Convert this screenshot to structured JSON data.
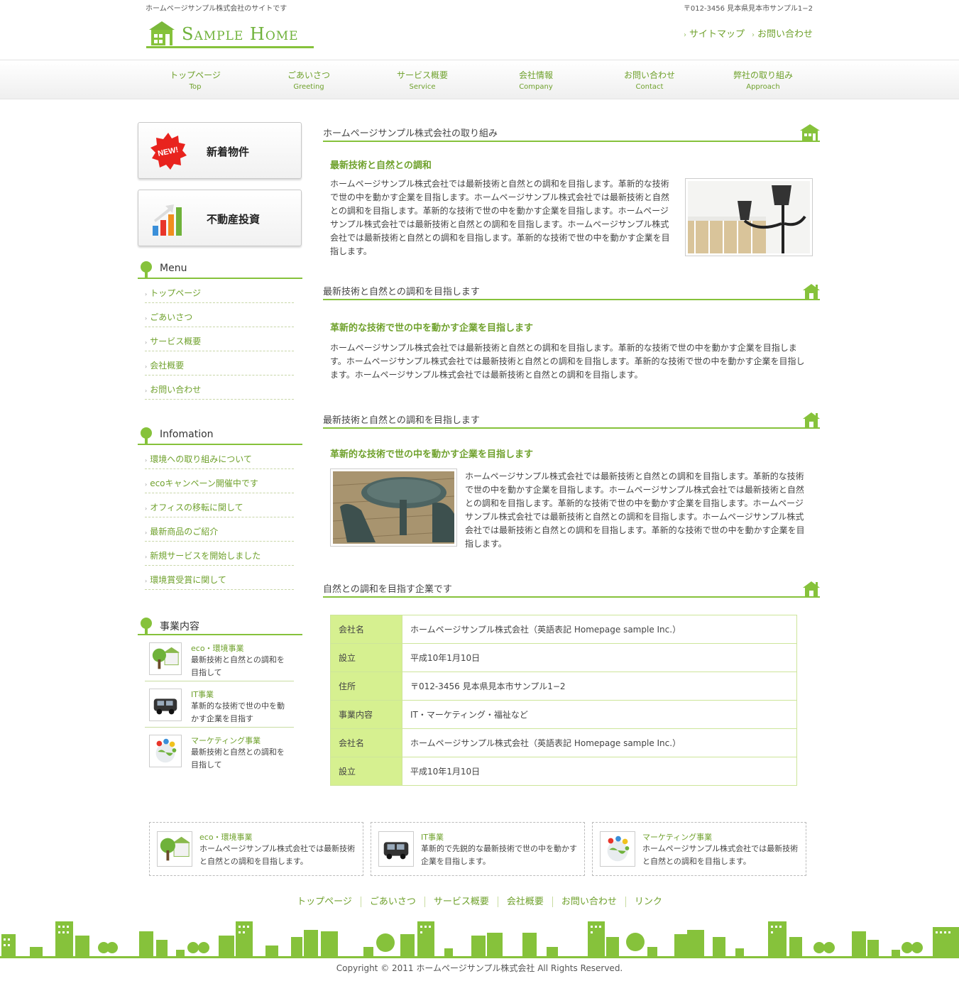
{
  "colors": {
    "accent": "#86c23b",
    "link": "#6fa12c",
    "table_key_bg": "#d6f090"
  },
  "header": {
    "tagline": "ホームページサンプル株式会社のサイトです",
    "address": "〒012-3456 見本県見本市サンプル1−2",
    "logo_text": "Sample Home",
    "links": [
      "サイトマップ",
      "お問い合わせ"
    ]
  },
  "gnav": [
    {
      "jp": "トップページ",
      "en": "Top"
    },
    {
      "jp": "ごあいさつ",
      "en": "Greeting"
    },
    {
      "jp": "サービス概要",
      "en": "Service"
    },
    {
      "jp": "会社情報",
      "en": "Company"
    },
    {
      "jp": "お問い合わせ",
      "en": "Contact"
    },
    {
      "jp": "弊社の取り組み",
      "en": "Approach"
    }
  ],
  "sidebar": {
    "new_button": {
      "badge": "NEW!",
      "label": "新着物件"
    },
    "invest_button": {
      "label": "不動産投資"
    },
    "menu_title": "Menu",
    "menu_items": [
      "トップページ",
      "ごあいさつ",
      "サービス概要",
      "会社概要",
      "お問い合わせ"
    ],
    "info_title": "Infomation",
    "info_items": [
      "環境への取り組みについて",
      "ecoキャンペーン開催中です",
      "オフィスの移転に関して",
      "最新商品のご紹介",
      "新規サービスを開始しました",
      "環境賞受賞に関して"
    ],
    "biz_title": "事業内容",
    "biz_items": [
      {
        "title": "eco・環境事業",
        "desc": "最新技術と自然との調和を目指して",
        "icon": "eco-house-icon"
      },
      {
        "title": "IT事業",
        "desc": "革新的な技術で世の中を動かす企業を目指す",
        "icon": "car-icon"
      },
      {
        "title": "マーケティング事業",
        "desc": "最新技術と自然との調和を目指して",
        "icon": "globe-icon"
      }
    ]
  },
  "main": {
    "sections": [
      {
        "title": "ホームページサンプル株式会社の取り組み",
        "subtitle": "最新技術と自然との調和",
        "text": "ホームページサンプル株式会社では最新技術と自然との調和を目指します。革新的な技術で世の中を動かす企業を目指します。ホームページサンプル株式会社では最新技術と自然との調和を目指します。革新的な技術で世の中を動かす企業を目指します。ホームページサンプル株式会社では最新技術と自然との調和を目指します。ホームページサンプル株式会社では最新技術と自然との調和を目指します。革新的な技術で世の中を動かす企業を目指します。"
      },
      {
        "title": "最新技術と自然との調和を目指します",
        "subtitle": "革新的な技術で世の中を動かす企業を目指します",
        "text": "ホームページサンプル株式会社では最新技術と自然との調和を目指します。革新的な技術で世の中を動かす企業を目指します。ホームページサンプル株式会社では最新技術と自然との調和を目指します。革新的な技術で世の中を動かす企業を目指します。ホームページサンプル株式会社では最新技術と自然との調和を目指します。"
      },
      {
        "title": "最新技術と自然との調和を目指します",
        "subtitle": "革新的な技術で世の中を動かす企業を目指します",
        "text": "ホームページサンプル株式会社では最新技術と自然との調和を目指します。革新的な技術で世の中を動かす企業を目指します。ホームページサンプル株式会社では最新技術と自然との調和を目指します。革新的な技術で世の中を動かす企業を目指します。ホームページサンプル株式会社では最新技術と自然との調和を目指します。ホームページサンプル株式会社では最新技術と自然との調和を目指します。革新的な技術で世の中を動かす企業を目指します。"
      },
      {
        "title": "自然との調和を目指す企業です"
      }
    ],
    "company_table": [
      {
        "key": "会社名",
        "value": "ホームページサンプル株式会社（英語表記 Homepage sample Inc.）"
      },
      {
        "key": "設立",
        "value": "平成10年1月10日"
      },
      {
        "key": "住所",
        "value": "〒012-3456 見本県見本市サンプル1−2"
      },
      {
        "key": "事業内容",
        "value": "IT・マーケティング・福祉など"
      },
      {
        "key": "会社名",
        "value": "ホームページサンプル株式会社（英語表記 Homepage sample Inc.）"
      },
      {
        "key": "設立",
        "value": "平成10年1月10日"
      }
    ]
  },
  "footer": {
    "boxes": [
      {
        "title": "eco・環境事業",
        "desc": "ホームページサンプル株式会社では最新技術と自然との調和を目指します。"
      },
      {
        "title": "IT事業",
        "desc": "革新的で先鋭的な最新技術で世の中を動かす企業を目指します。"
      },
      {
        "title": "マーケティング事業",
        "desc": "ホームページサンプル株式会社では最新技術と自然との調和を目指します。"
      }
    ],
    "nav": [
      "トップページ",
      "ごあいさつ",
      "サービス概要",
      "会社概要",
      "お問い合わせ",
      "リンク"
    ],
    "copyright": "Copyright © 2011 ホームページサンプル株式会社 All Rights Reserved."
  }
}
